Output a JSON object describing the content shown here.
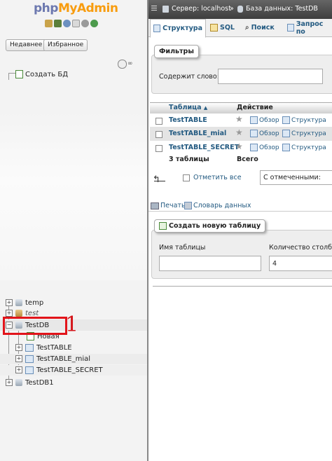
{
  "sidebar": {
    "logo_php": "php",
    "logo_my": "MyAdmin",
    "recent_btn": "Недавнее",
    "favorites_btn": "Избранное",
    "create_db": "Создать БД",
    "tree": [
      {
        "label": "temp"
      },
      {
        "label": "test"
      },
      {
        "label": "TestDB"
      },
      {
        "label": "Новая"
      },
      {
        "label": "TestTABLE"
      },
      {
        "label": "TestTABLE_mial"
      },
      {
        "label": "TestTABLE_SECRET"
      },
      {
        "label": "TestDB1"
      }
    ],
    "annotation_number": "1"
  },
  "breadcrumb": {
    "server": "Сервер: localhost",
    "sep": "»",
    "database": "База данных: TestDB"
  },
  "tabs": [
    {
      "label": "Структура"
    },
    {
      "label": "SQL"
    },
    {
      "label": "Поиск"
    },
    {
      "label": "Запрос по"
    }
  ],
  "filters": {
    "legend": "Фильтры",
    "label": "Содержит слово:",
    "value": ""
  },
  "table": {
    "col_table": "Таблица",
    "col_action": "Действие",
    "rows": [
      {
        "name": "TestTABLE",
        "browse": "Обзор",
        "structure": "Структура"
      },
      {
        "name": "TestTABLE_mial",
        "browse": "Обзор",
        "structure": "Структура"
      },
      {
        "name": "TestTABLE_SECRET",
        "browse": "Обзор",
        "structure": "Структура"
      }
    ],
    "count": "3 таблицы",
    "total": "Всего"
  },
  "bulk": {
    "check_all": "Отметить все",
    "with_selected": "С отмеченными:"
  },
  "links": {
    "print": "Печать",
    "dictionary": "Словарь данных"
  },
  "create_table": {
    "legend": "Создать новую таблицу",
    "name_label": "Имя таблицы",
    "name_value": "",
    "cols_label": "Количество столбцов",
    "cols_value": "4"
  },
  "colors": {
    "highlight_red": "#e2141a",
    "link_blue": "#235a81",
    "topbar": "#4a4a4a"
  }
}
